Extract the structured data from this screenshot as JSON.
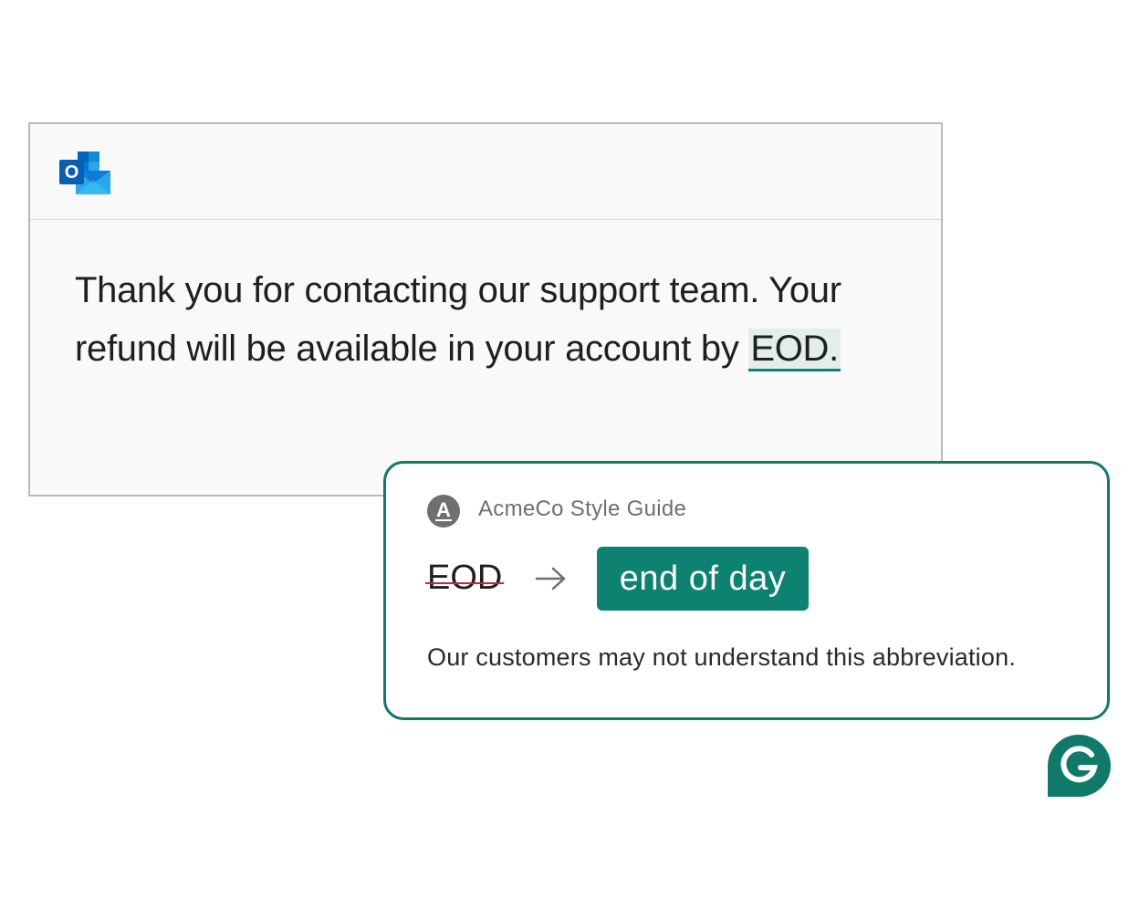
{
  "email": {
    "app_icon": "outlook-icon",
    "body_text": "Thank you for contacting our support team. Your refund will be available in your account by ",
    "flagged_text": "EOD."
  },
  "suggestion": {
    "source_icon": "letter-a-icon",
    "source_badge_letter": "A",
    "source_name": "AcmeCo Style Guide",
    "original": "EOD",
    "arrow_icon": "right-arrow-icon",
    "replacement": "end of day",
    "explanation": "Our customers may not understand this abbreviation."
  },
  "branding": {
    "grammarly_icon": "grammarly-g-icon"
  },
  "colors": {
    "accent": "#0d8270",
    "card_border": "#0f7a6a",
    "strike": "#c9243f",
    "highlight_bg": "#e2eeea"
  }
}
